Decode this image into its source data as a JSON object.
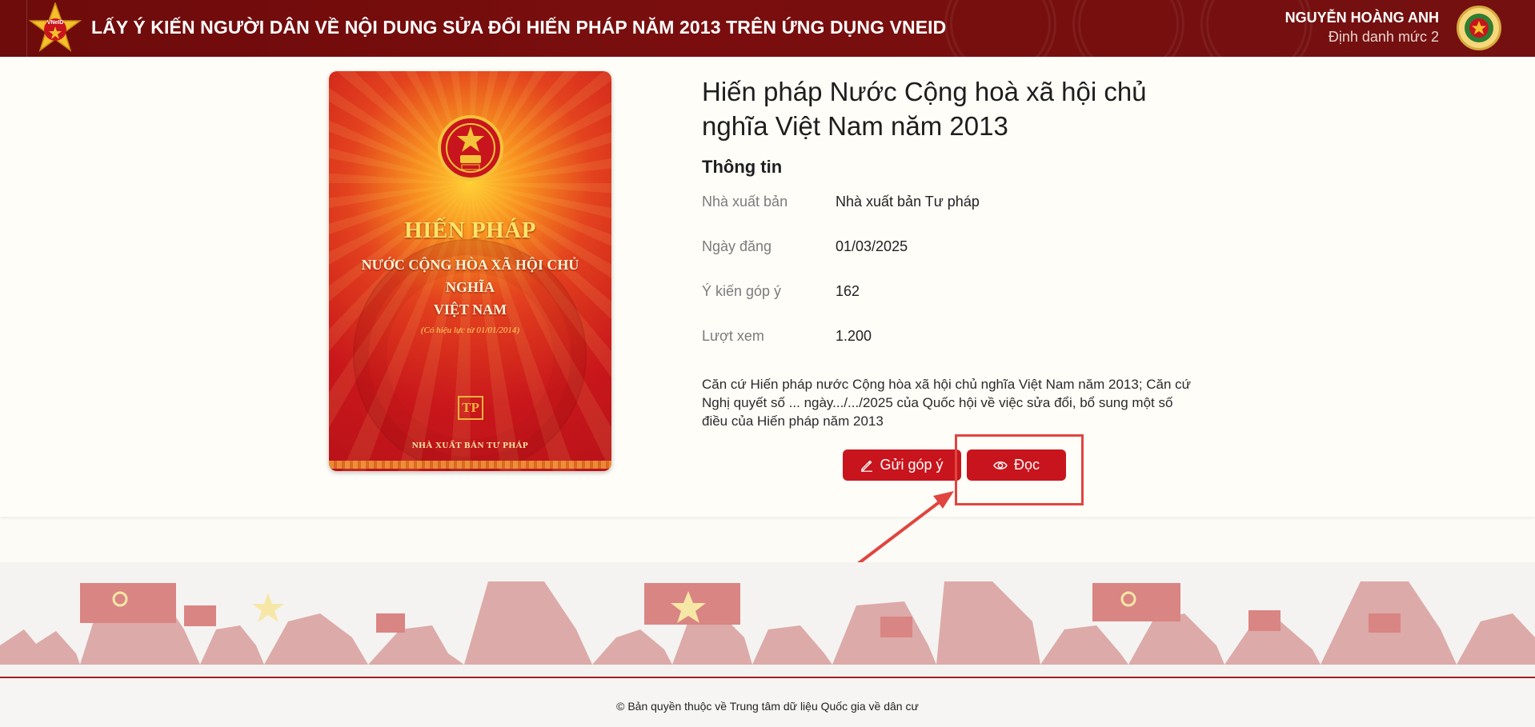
{
  "header": {
    "title": "LẤY Ý KIẾN NGƯỜI DÂN VỀ NỘI DUNG SỬA ĐỔI HIẾN PHÁP NĂM 2013 TRÊN ỨNG DỤNG VNEID",
    "logo_text": "VNeID",
    "user_name": "NGUYỄN HOÀNG ANH",
    "user_level": "Định danh mức 2"
  },
  "book_cover": {
    "title": "HIẾN PHÁP",
    "subtitle_line1": "NƯỚC CỘNG HÒA XÃ HỘI CHỦ NGHĨA",
    "subtitle_line2": "VIỆT NAM",
    "effective": "(Có hiệu lực từ 01/01/2014)",
    "publisher_mark": "TP",
    "publisher": "NHÀ XUẤT BẢN TƯ PHÁP"
  },
  "document": {
    "title": "Hiến pháp Nước Cộng hoà xã hội chủ nghĩa Việt Nam năm 2013",
    "section_heading": "Thông tin",
    "info": [
      {
        "label": "Nhà xuất bản",
        "value": "Nhà xuất bản Tư pháp"
      },
      {
        "label": "Ngày đăng",
        "value": "01/03/2025"
      },
      {
        "label": "Ý kiến góp ý",
        "value": "162"
      },
      {
        "label": "Lượt xem",
        "value": "1.200"
      }
    ],
    "description": "Căn cứ Hiến pháp nước Cộng hòa xã hội chủ nghĩa Việt Nam năm 2013; Căn cứ Nghị quyết số ... ngày.../.../2025 của Quốc hội về việc sửa đổi, bổ sung một số điều của Hiến pháp năm 2013"
  },
  "actions": {
    "feedback_label": "Gửi góp ý",
    "feedback_icon": "pencil-icon",
    "read_label": "Đọc",
    "read_icon": "eye-icon"
  },
  "footer": {
    "copyright": "© Bản quyền thuộc về Trung tâm dữ liệu Quốc gia về dân cư"
  },
  "colors": {
    "header_bg": "#7a0e0e",
    "accent_red": "#c8151d",
    "highlight": "#e0453f"
  }
}
